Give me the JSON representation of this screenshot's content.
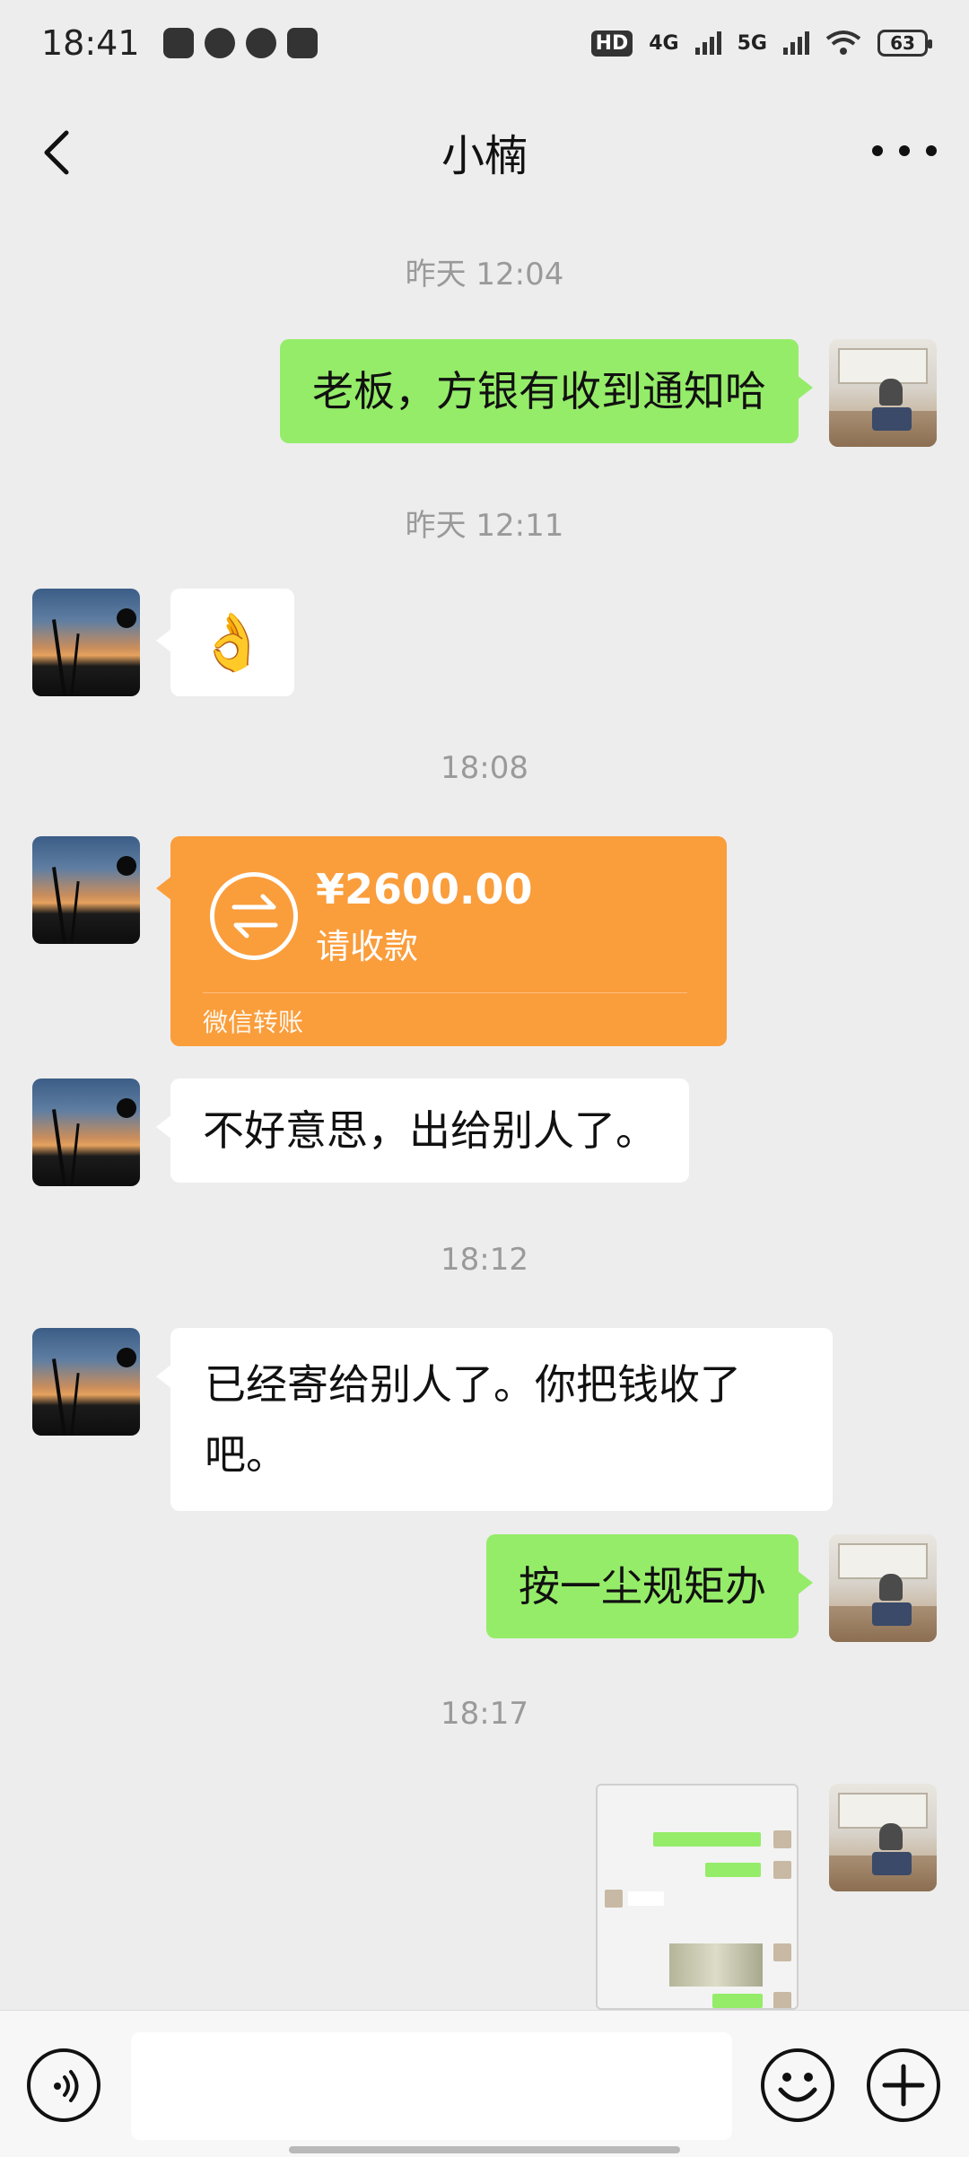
{
  "status_bar": {
    "time": "18:41",
    "network_1": "4G",
    "network_2": "5G",
    "hd_label": "HD",
    "battery": "63",
    "left_icons": [
      "music-icon",
      "cast-icon",
      "message-icon",
      "app-icon"
    ]
  },
  "header": {
    "title": "小楠",
    "back_icon": "chevron-left-icon",
    "more_icon": "more-dots-icon"
  },
  "messages": [
    {
      "type": "timestamp",
      "text": "昨天 12:04"
    },
    {
      "type": "text",
      "sender": "self",
      "text": "老板，方银有收到通知哈"
    },
    {
      "type": "timestamp",
      "text": "昨天 12:11"
    },
    {
      "type": "emoji",
      "sender": "other",
      "text": "👌"
    },
    {
      "type": "timestamp",
      "text": "18:08"
    },
    {
      "type": "transfer",
      "sender": "other",
      "amount": "¥2600.00",
      "note": "请收款",
      "footer": "微信转账"
    },
    {
      "type": "text",
      "sender": "other",
      "text": "不好意思，出给别人了。"
    },
    {
      "type": "timestamp",
      "text": "18:12"
    },
    {
      "type": "text",
      "sender": "other",
      "text": "已经寄给别人了。你把钱收了吧。"
    },
    {
      "type": "text",
      "sender": "self",
      "text": "按一尘规矩办"
    },
    {
      "type": "timestamp",
      "text": "18:17"
    },
    {
      "type": "image",
      "sender": "self"
    }
  ],
  "input_bar": {
    "voice_icon": "voice-icon",
    "emoji_icon": "emoji-icon",
    "plus_icon": "plus-icon",
    "value": ""
  },
  "colors": {
    "self_bubble": "#95ec69",
    "other_bubble": "#ffffff",
    "transfer_card": "#fa9d3b",
    "background": "#ededed"
  }
}
